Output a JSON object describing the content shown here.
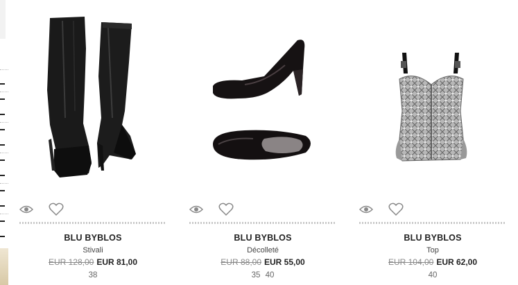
{
  "products": [
    {
      "brand": "BLU BYBLOS",
      "category": "Stivali",
      "old_price": "EUR 128,00",
      "new_price": "EUR 81,00",
      "sizes": "38",
      "image": "black-leather-knee-boots"
    },
    {
      "brand": "BLU BYBLOS",
      "category": "Décolleté",
      "old_price": "EUR 88,00",
      "new_price": "EUR 55,00",
      "sizes": "35 40",
      "image": "black-patent-pumps"
    },
    {
      "brand": "BLU BYBLOS",
      "category": "Top",
      "old_price": "EUR 104,00",
      "new_price": "EUR 62,00",
      "sizes": "40",
      "image": "grey-patterned-corset-top"
    }
  ],
  "icons": {
    "quick_view": "eye-icon",
    "wishlist": "heart-icon"
  }
}
